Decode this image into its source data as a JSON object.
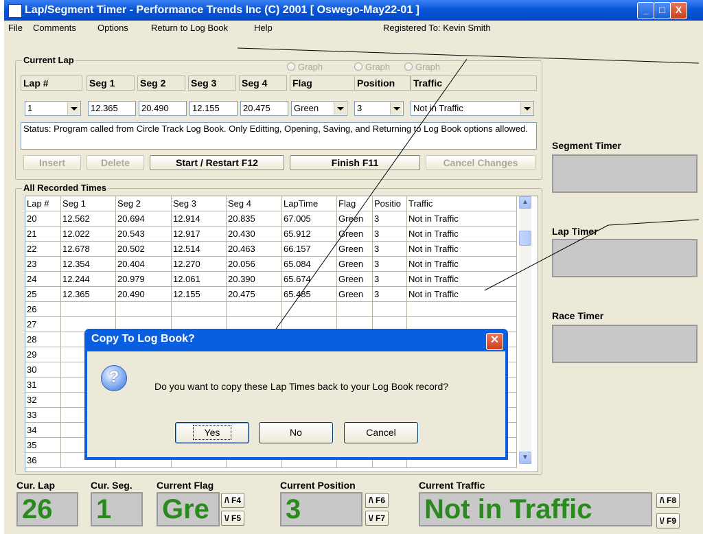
{
  "window": {
    "title": "Lap/Segment Timer - Performance Trends Inc (C) 2001   [ Oswego-May22-01 ]",
    "controls": {
      "minimize": "_",
      "maximize": "□",
      "close": "X"
    }
  },
  "menu": {
    "items": [
      "File",
      "Comments",
      "Options",
      "Return to Log Book",
      "Help"
    ],
    "registered": "Registered To:   Kevin Smith"
  },
  "current_lap": {
    "title": "Current Lap",
    "graph_radios": [
      "Graph",
      "Graph",
      "Graph"
    ],
    "headers": [
      "Lap #",
      "Seg 1",
      "Seg 2",
      "Seg 3",
      "Seg 4",
      "Flag",
      "Position",
      "Traffic"
    ],
    "lap_number": "1",
    "seg1": "12.365",
    "seg2": "20.490",
    "seg3": "12.155",
    "seg4": "20.475",
    "flag": "Green",
    "position": "3",
    "traffic": "Not in Traffic",
    "status": "Status: Program called from Circle Track Log Book.  Only Editting, Opening, Saving, and Returning to Log Book options allowed.",
    "buttons": {
      "insert": "Insert",
      "delete": "Delete",
      "start": "Start / Restart F12",
      "finish": "Finish F11",
      "cancel_changes": "Cancel Changes"
    }
  },
  "recorded": {
    "title": "All Recorded Times",
    "columns": [
      "Lap #",
      "Seg 1",
      "Seg 2",
      "Seg 3",
      "Seg 4",
      "LapTime",
      "Flag",
      "Positio",
      "Traffic"
    ],
    "rows": [
      [
        "20",
        "12.562",
        "20.694",
        "12.914",
        "20.835",
        "67.005",
        "Green",
        "3",
        "Not in Traffic"
      ],
      [
        "21",
        "12.022",
        "20.543",
        "12.917",
        "20.430",
        "65.912",
        "Green",
        "3",
        "Not in Traffic"
      ],
      [
        "22",
        "12.678",
        "20.502",
        "12.514",
        "20.463",
        "66.157",
        "Green",
        "3",
        "Not in Traffic"
      ],
      [
        "23",
        "12.354",
        "20.404",
        "12.270",
        "20.056",
        "65.084",
        "Green",
        "3",
        "Not in Traffic"
      ],
      [
        "24",
        "12.244",
        "20.979",
        "12.061",
        "20.390",
        "65.674",
        "Green",
        "3",
        "Not in Traffic"
      ],
      [
        "25",
        "12.365",
        "20.490",
        "12.155",
        "20.475",
        "65.485",
        "Green",
        "3",
        "Not in Traffic"
      ]
    ],
    "empty_rows": [
      "26",
      "27",
      "28",
      "29",
      "30",
      "31",
      "32",
      "33",
      "34",
      "35",
      "36"
    ]
  },
  "timers": {
    "segment": "Segment Timer",
    "lap": "Lap Timer",
    "race": "Race Timer"
  },
  "status_bar": {
    "cur_lap_label": "Cur. Lap",
    "cur_lap": "26",
    "cur_seg_label": "Cur. Seg.",
    "cur_seg": "1",
    "flag_label": "Current Flag",
    "flag": "Gre",
    "position_label": "Current Position",
    "position": "3",
    "traffic_label": "Current Traffic",
    "traffic": "Not in Traffic",
    "keys": {
      "f4": "/\\ F4",
      "f5": "\\/ F5",
      "f6": "/\\ F6",
      "f7": "\\/ F7",
      "f8": "/\\ F8",
      "f9": "\\/ F9"
    }
  },
  "dialog": {
    "title": "Copy To Log Book?",
    "message": "Do you want to copy these Lap Times back to your Log Book record?",
    "buttons": {
      "yes": "Yes",
      "no": "No",
      "cancel": "Cancel"
    }
  },
  "colors": {
    "titlebar": "#0a56d8",
    "big_text": "#2a8a1e",
    "timer_box": "#c8c8c8"
  }
}
